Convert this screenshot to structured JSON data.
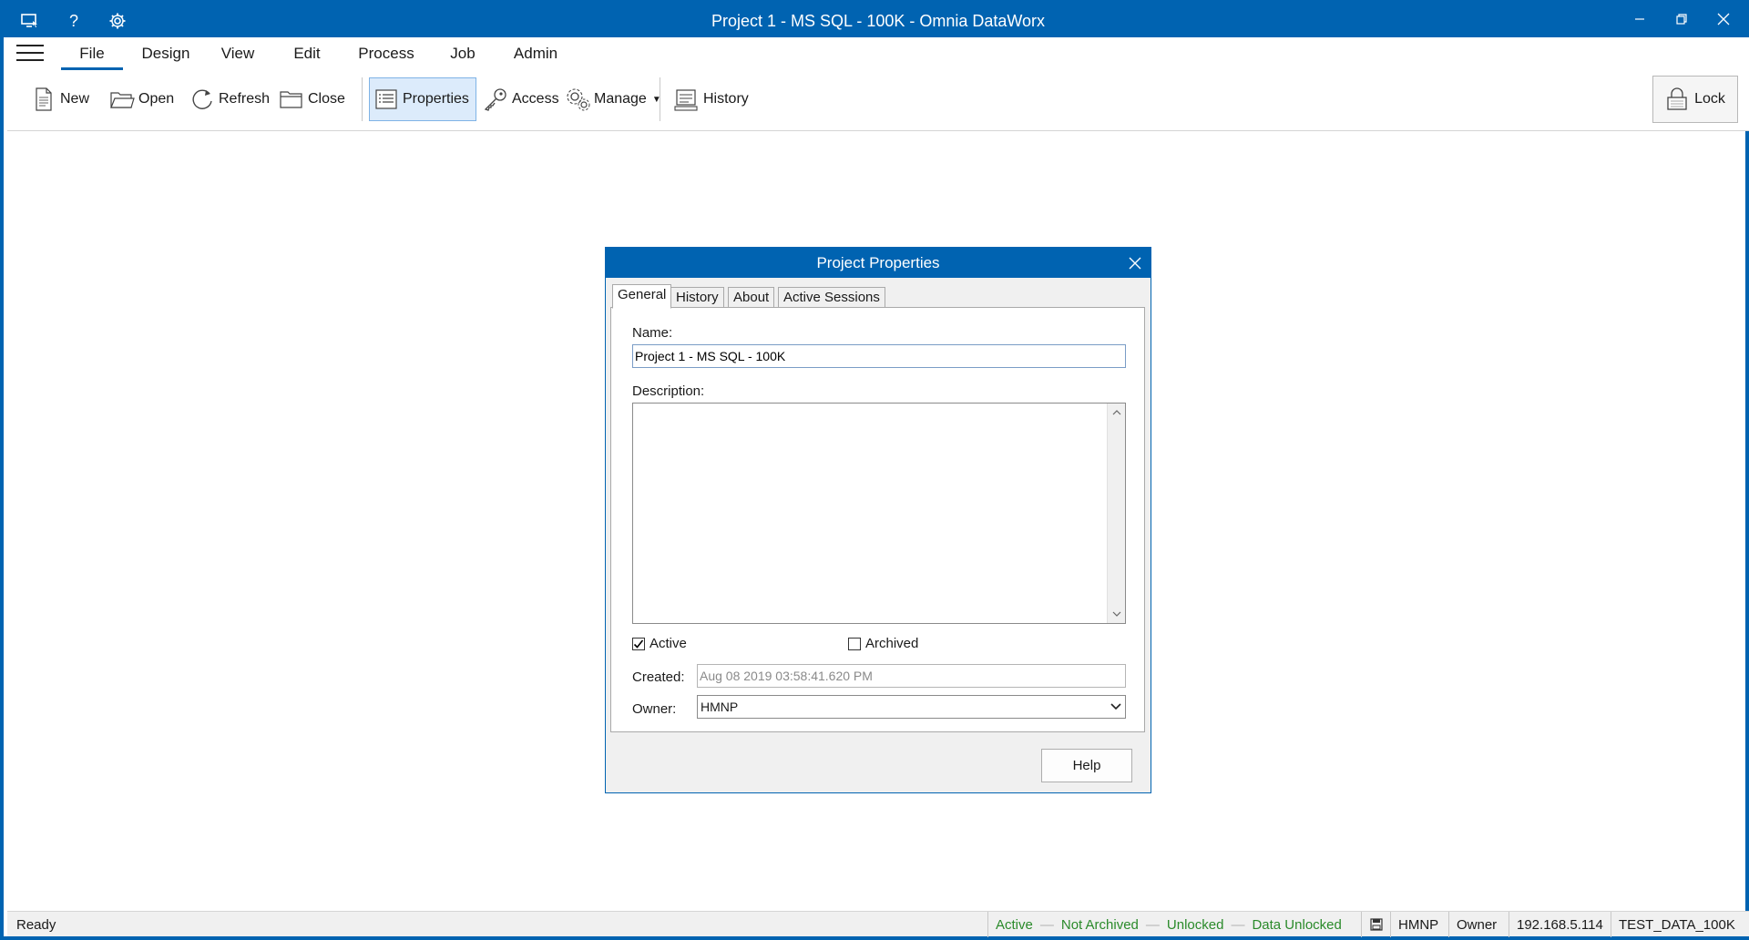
{
  "window": {
    "title": "Project 1 - MS SQL - 100K - Omnia DataWorx",
    "left_icons": [
      "screen-icon",
      "help-icon",
      "gear-icon"
    ],
    "help_glyph": "?"
  },
  "menu": {
    "items": [
      "File",
      "Design",
      "View",
      "Edit",
      "Process",
      "Job",
      "Admin"
    ],
    "active": "File"
  },
  "ribbon": {
    "new_label": "New",
    "open_label": "Open",
    "refresh_label": "Refresh",
    "close_label": "Close",
    "properties_label": "Properties",
    "access_label": "Access",
    "manage_label": "Manage",
    "history_label": "History",
    "lock_label": "Lock"
  },
  "dialog": {
    "title": "Project Properties",
    "tabs": [
      "General",
      "History",
      "About",
      "Active Sessions"
    ],
    "active_tab": "General",
    "name_label": "Name:",
    "name_value": "Project 1 - MS SQL - 100K",
    "description_label": "Description:",
    "description_value": "",
    "active_label": "Active",
    "active_checked": true,
    "archived_label": "Archived",
    "archived_checked": false,
    "created_label": "Created:",
    "created_value": "Aug 08 2019 03:58:41.620 PM",
    "owner_label": "Owner:",
    "owner_value": "HMNP",
    "help_label": "Help"
  },
  "statusbar": {
    "ready": "Ready",
    "active": "Active",
    "not_archived": "Not Archived",
    "unlocked": "Unlocked",
    "data_unlocked": "Data Unlocked",
    "user": "HMNP",
    "role": "Owner",
    "ip": "192.168.5.114",
    "database": "TEST_DATA_100K",
    "status_color": "#2a8a2a"
  },
  "colors": {
    "accent": "#0063b1",
    "selected_bg": "#dcebfb"
  }
}
